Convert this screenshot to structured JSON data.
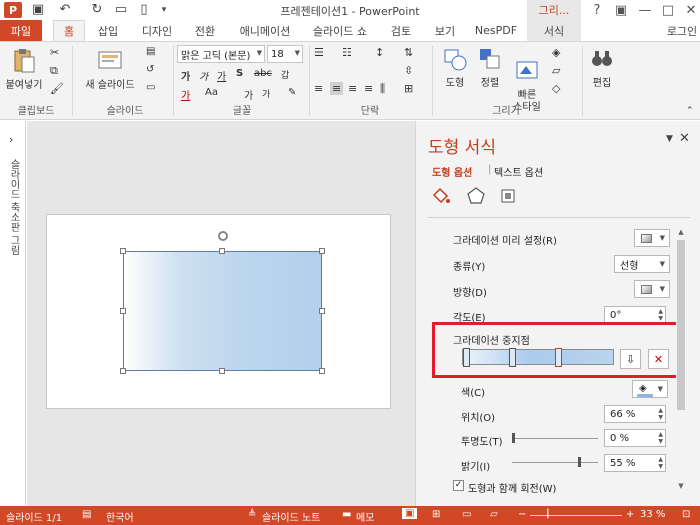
{
  "window": {
    "title": "프레젠테이션1 - PowerPoint",
    "context_tab_title": "그리...",
    "user": "로그인",
    "controls": [
      "?",
      "▣",
      "—",
      "□",
      "✕"
    ]
  },
  "tabs": [
    {
      "label": "파일"
    },
    {
      "label": "홈"
    },
    {
      "label": "삽입"
    },
    {
      "label": "디자인"
    },
    {
      "label": "전환"
    },
    {
      "label": "애니메이션"
    },
    {
      "label": "슬라이드 쇼"
    },
    {
      "label": "검토"
    },
    {
      "label": "보기"
    },
    {
      "label": "NesPDF"
    },
    {
      "label": "서식"
    }
  ],
  "ribbon": {
    "clipboard": {
      "paste": "붙여넣기",
      "label": "클립보드"
    },
    "slides": {
      "new_slide": "새 슬라이드",
      "label": "슬라이드"
    },
    "font": {
      "family": "맑은 고딕 (본문)",
      "size": "18",
      "label": "글꼴"
    },
    "paragraph": {
      "label": "단락"
    },
    "drawing": {
      "shape": "도형",
      "arrange": "정렬",
      "quick_styles": "빠른\n스타일",
      "label": "그리기"
    },
    "editing": {
      "edit": "편집"
    }
  },
  "thumbnail_panel": {
    "label": "슬라이드 축소판 그림"
  },
  "format_pane": {
    "title": "도형 서식",
    "tabs": [
      "도형 옵션",
      "텍스트 옵션"
    ],
    "gradient_preset": "그라데이션 미리 설정(R)",
    "type_label": "종류(Y)",
    "type_value": "선형",
    "direction_label": "방향(D)",
    "angle_label": "각도(E)",
    "angle_value": "0°",
    "stops_label": "그라데이션 중지점",
    "color_label": "색(C)",
    "position_label": "위치(O)",
    "position_value": "66 %",
    "transparency_label": "투명도(T)",
    "transparency_value": "0 %",
    "brightness_label": "밝기(I)",
    "brightness_value": "55 %",
    "rotate_with_shape": "도형과 함께 회전(W)",
    "rotate_checked": true
  },
  "status_bar": {
    "slide": "슬라이드 1/1",
    "language": "한국어",
    "notes": "슬라이드 노트",
    "comments": "메모",
    "zoom": "33 %"
  },
  "colors": {
    "accent": "#d24726",
    "title": "#c43e1c",
    "highlight": "#e8192c",
    "shape_fill": "#bcd6ee"
  }
}
